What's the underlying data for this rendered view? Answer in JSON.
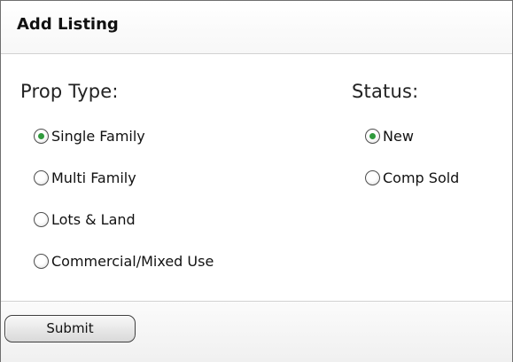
{
  "header": {
    "title": "Add Listing"
  },
  "prop_type": {
    "label": "Prop Type:",
    "selected": "Single Family",
    "options": [
      {
        "label": "Single Family",
        "checked": true
      },
      {
        "label": "Multi Family",
        "checked": false
      },
      {
        "label": "Lots & Land",
        "checked": false
      },
      {
        "label": "Commercial/Mixed Use",
        "checked": false
      }
    ]
  },
  "status": {
    "label": "Status:",
    "selected": "New",
    "options": [
      {
        "label": "New",
        "checked": true
      },
      {
        "label": "Comp Sold",
        "checked": false
      }
    ]
  },
  "footer": {
    "submit_label": "Submit"
  },
  "colors": {
    "radio_checked": "#2f9a3c",
    "border": "#6f6f6f"
  },
  "icons": {
    "radio_checked": "radio-checked-icon",
    "radio_unchecked": "radio-unchecked-icon"
  }
}
